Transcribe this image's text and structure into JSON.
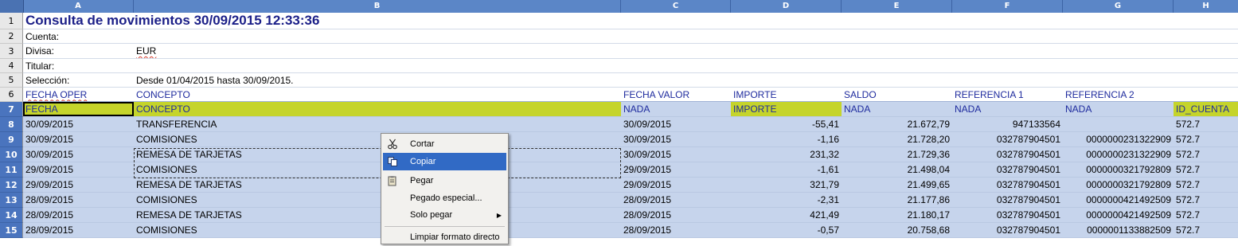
{
  "columns": [
    "A",
    "B",
    "C",
    "D",
    "E",
    "F",
    "G",
    "H"
  ],
  "row_numbers": [
    "1",
    "2",
    "3",
    "4",
    "5",
    "6",
    "7",
    "8",
    "9",
    "10",
    "11",
    "12",
    "13",
    "14",
    "15"
  ],
  "title": "Consulta de movimientos 30/09/2015 12:33:36",
  "info": {
    "cuenta_label": "Cuenta:",
    "divisa_label": "Divisa:",
    "divisa_value": "EUR",
    "titular_label": "Titular:",
    "seleccion_label": "Selección:",
    "seleccion_value": "Desde 01/04/2015 hasta 30/09/2015."
  },
  "header_row_6": [
    "FECHA OPER",
    "CONCEPTO",
    "FECHA VALOR",
    "IMPORTE",
    "SALDO",
    "REFERENCIA 1",
    "REFERENCIA 2",
    ""
  ],
  "header_row_7": [
    "FECHA",
    "CONCEPTO",
    "NADA",
    "IMPORTE",
    "NADA",
    "NADA",
    "NADA",
    "ID_CUENTA"
  ],
  "rows": [
    [
      "30/09/2015",
      "TRANSFERENCIA",
      "30/09/2015",
      "-55,41",
      "21.672,79",
      "947133564",
      "",
      "572.7"
    ],
    [
      "30/09/2015",
      "COMISIONES",
      "30/09/2015",
      "-1,16",
      "21.728,20",
      "032787904501",
      "0000000231322909",
      "572.7"
    ],
    [
      "30/09/2015",
      "REMESA DE TARJETAS",
      "30/09/2015",
      "231,32",
      "21.729,36",
      "032787904501",
      "0000000231322909",
      "572.7"
    ],
    [
      "29/09/2015",
      "COMISIONES",
      "29/09/2015",
      "-1,61",
      "21.498,04",
      "032787904501",
      "0000000321792809",
      "572.7"
    ],
    [
      "29/09/2015",
      "REMESA DE TARJETAS",
      "29/09/2015",
      "321,79",
      "21.499,65",
      "032787904501",
      "0000000321792809",
      "572.7"
    ],
    [
      "28/09/2015",
      "COMISIONES",
      "28/09/2015",
      "-2,31",
      "21.177,86",
      "032787904501",
      "0000000421492509",
      "572.7"
    ],
    [
      "28/09/2015",
      "REMESA DE TARJETAS",
      "28/09/2015",
      "421,49",
      "21.180,17",
      "032787904501",
      "0000000421492509",
      "572.7"
    ],
    [
      "28/09/2015",
      "COMISIONES",
      "28/09/2015",
      "-0,57",
      "20.758,68",
      "032787904501",
      "0000001133882509",
      "572.7"
    ]
  ],
  "context_menu": {
    "cut": "Cortar",
    "copy": "Copiar",
    "paste": "Pegar",
    "paste_special": "Pegado especial...",
    "paste_only": "Solo pegar",
    "clear_format": "Limpiar formato directo",
    "icons": [
      "scissors-icon",
      "copy-icon",
      "paste-icon"
    ]
  },
  "colors": {
    "header_bar": "#5b86c7",
    "row_selected": "#c6d4ec",
    "highlight": "#c5d42b",
    "menu_hover": "#316ac5"
  }
}
